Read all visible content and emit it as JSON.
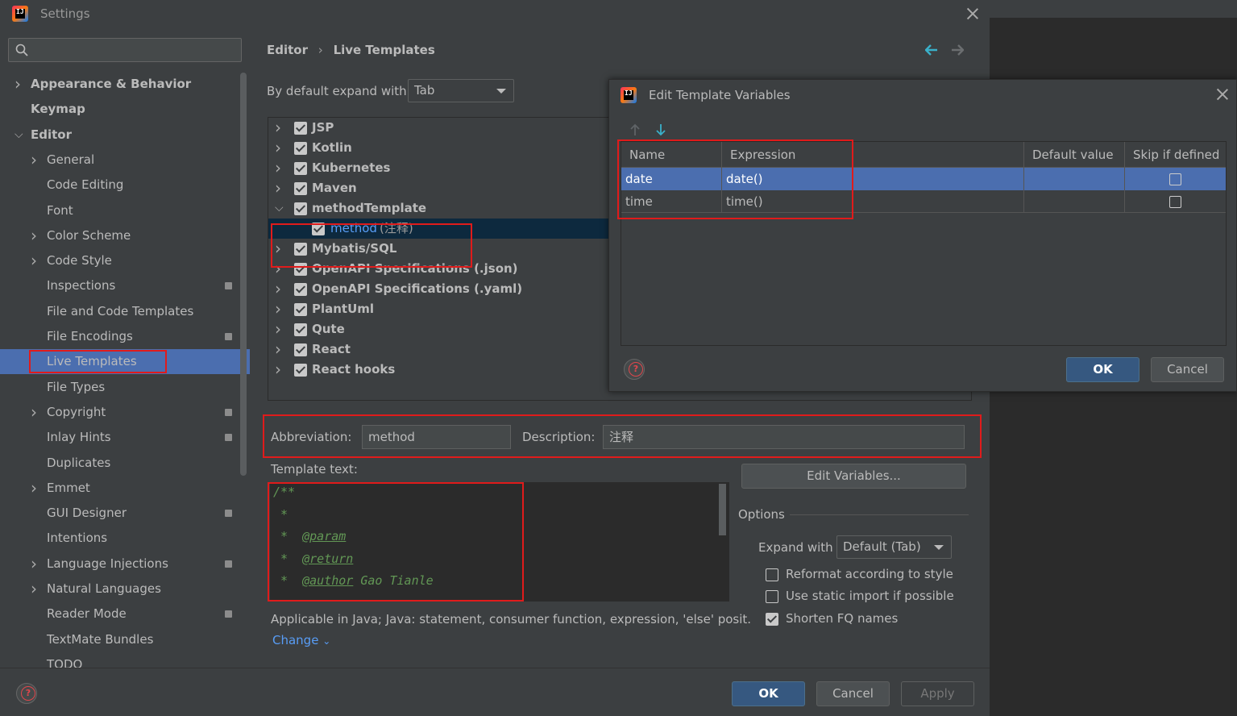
{
  "window": {
    "title": "Settings"
  },
  "search": {
    "placeholder": ""
  },
  "sidebar": {
    "items": [
      {
        "label": "Appearance & Behavior",
        "bold": true,
        "chevron": ">"
      },
      {
        "label": "Keymap",
        "bold": true
      },
      {
        "label": "Editor",
        "bold": true,
        "chevron": "v"
      },
      {
        "label": "General",
        "chevron": ">"
      },
      {
        "label": "Code Editing"
      },
      {
        "label": "Font"
      },
      {
        "label": "Color Scheme",
        "chevron": ">"
      },
      {
        "label": "Code Style",
        "chevron": ">"
      },
      {
        "label": "Inspections",
        "badge": true
      },
      {
        "label": "File and Code Templates"
      },
      {
        "label": "File Encodings",
        "badge": true
      },
      {
        "label": "Live Templates",
        "selected": true
      },
      {
        "label": "File Types"
      },
      {
        "label": "Copyright",
        "chevron": ">",
        "badge": true
      },
      {
        "label": "Inlay Hints",
        "badge": true
      },
      {
        "label": "Duplicates"
      },
      {
        "label": "Emmet",
        "chevron": ">"
      },
      {
        "label": "GUI Designer",
        "badge": true
      },
      {
        "label": "Intentions"
      },
      {
        "label": "Language Injections",
        "chevron": ">",
        "badge": true
      },
      {
        "label": "Natural Languages",
        "chevron": ">"
      },
      {
        "label": "Reader Mode",
        "badge": true
      },
      {
        "label": "TextMate Bundles"
      },
      {
        "label": "TODO"
      }
    ]
  },
  "breadcrumb": {
    "parent": "Editor",
    "separator": "›",
    "current": "Live Templates"
  },
  "expand": {
    "label": "By default expand with",
    "value": "Tab"
  },
  "tree": {
    "groups": [
      {
        "label": "JSP"
      },
      {
        "label": "Kotlin"
      },
      {
        "label": "Kubernetes"
      },
      {
        "label": "Maven"
      },
      {
        "label": "methodTemplate",
        "expanded": true
      },
      {
        "label": "method",
        "suffix": "(注释)",
        "child": true,
        "selected": true
      },
      {
        "label": "Mybatis/SQL"
      },
      {
        "label": "OpenAPI Specifications (.json)"
      },
      {
        "label": "OpenAPI Specifications (.yaml)"
      },
      {
        "label": "PlantUml"
      },
      {
        "label": "Qute"
      },
      {
        "label": "React"
      },
      {
        "label": "React hooks"
      }
    ]
  },
  "form": {
    "abbreviation_label": "Abbreviation:",
    "abbreviation_value": "method",
    "description_label": "Description:",
    "description_value": "注释",
    "template_text_label": "Template text:",
    "edit_variables": "Edit Variables...",
    "template_lines": [
      {
        "star": "/**",
        "tag": "",
        "rest": ""
      },
      {
        "star": " *",
        "tag": "",
        "rest": ""
      },
      {
        "star": " *",
        "tag": "@param",
        "rest": ""
      },
      {
        "star": " *",
        "tag": "@return",
        "rest": ""
      },
      {
        "star": " *",
        "tag": "@author",
        "rest": "Gao Tianle"
      }
    ],
    "applicable": "Applicable in Java; Java: statement, consumer function, expression, 'else' posit.",
    "change": "Change"
  },
  "options": {
    "title": "Options",
    "expand_label": "Expand with",
    "expand_value": "Default (Tab)",
    "reformat": "Reformat according to style",
    "static_import": "Use static import if possible",
    "shorten": "Shorten FQ names"
  },
  "footer": {
    "ok": "OK",
    "cancel": "Cancel",
    "apply": "Apply"
  },
  "dialog": {
    "title": "Edit Template Variables",
    "columns": [
      "Name",
      "Expression",
      "Default value",
      "Skip if defined"
    ],
    "rows": [
      {
        "name": "date",
        "expression": "date()",
        "default": "",
        "skip": false
      },
      {
        "name": "time",
        "expression": "time()",
        "default": "",
        "skip": false
      }
    ],
    "ok": "OK",
    "cancel": "Cancel"
  },
  "colors": {
    "accent": "#4b6eaf",
    "highlight": "#e01b1b",
    "primary_button": "#365880"
  }
}
